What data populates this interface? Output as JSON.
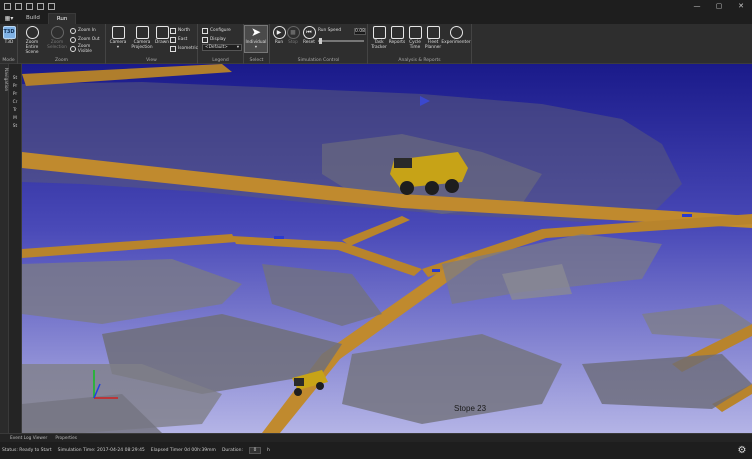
{
  "tabs": [
    {
      "label": "Build"
    },
    {
      "label": "Run"
    }
  ],
  "window": {
    "minimize": "—",
    "maximize": "▢",
    "close": "✕"
  },
  "ribbon": {
    "mode": {
      "label": "Mode",
      "t3d": "T3D"
    },
    "zoom": {
      "label": "Zoom",
      "zoom_entire_scene": "Zoom Entire Scene",
      "zoom_selection": "Zoom Selection",
      "zoom_in": "Zoom In",
      "zoom_out": "Zoom Out",
      "zoom_visible": "Zoom Visible"
    },
    "view": {
      "label": "View",
      "camera": "Camera",
      "camera_projection": "Camera Projection",
      "drawn": "Drawn",
      "north": "North",
      "east": "East",
      "isometric": "Isometric"
    },
    "legend": {
      "label": "Legend",
      "configure": "Configure",
      "display": "Display",
      "default_option": "<Default>"
    },
    "select": {
      "label": "Select",
      "individual": "Individual"
    },
    "simulation": {
      "label": "Simulation Control",
      "run": "Run",
      "stop": "Stop",
      "reset": "Reset",
      "run_speed": "Run Speed",
      "run_speed_value": "0.08"
    },
    "analysis": {
      "label": "Analysis & Reports",
      "task_tracker": "Task Tracker",
      "reports": "Reports",
      "cycle_time": "Cycle Time",
      "fleet_planner": "Fleet Planner",
      "experimenter": "Experimenter"
    }
  },
  "rail": {
    "navigation": "Navigation"
  },
  "panel_items": [
    "St",
    "Pr",
    "Pr",
    "Cr",
    "Tr",
    "M",
    "St"
  ],
  "viewport": {
    "stope_label": "Stope 23",
    "colors": {
      "sky_top": "#1a1a8a",
      "sky_bottom": "#b4b4e6",
      "road": "#c08a2e",
      "rock": "#6a6a78",
      "truck": "#c7a317"
    }
  },
  "bottom_tabs": [
    "Event Log Viewer",
    "Properties"
  ],
  "status": {
    "status_text": "Status: Ready to Start",
    "simulation_time": "Simulation Time: 2017-04-24 08:29:45",
    "elapsed_timer": "Elapsed Timer 0d 00h:39mm",
    "duration_label": "Duration:",
    "duration_value": "0",
    "duration_unit": "h"
  }
}
